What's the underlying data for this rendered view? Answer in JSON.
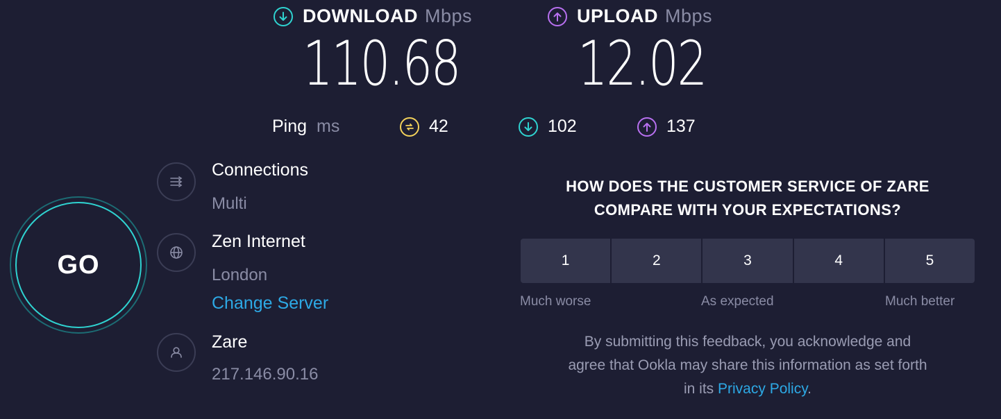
{
  "download": {
    "title": "DOWNLOAD",
    "unit": "Mbps",
    "value": "110.68",
    "icon": "arrow-down-circle-icon",
    "color": "#2fd3d1"
  },
  "upload": {
    "title": "UPLOAD",
    "unit": "Mbps",
    "value": "12.02",
    "icon": "arrow-up-circle-icon",
    "color": "#b870f0"
  },
  "ping": {
    "label": "Ping",
    "unit": "ms",
    "idle": {
      "value": "42",
      "icon": "ping-idle-icon",
      "color": "#f2d15a"
    },
    "download": {
      "value": "102",
      "icon": "ping-download-icon",
      "color": "#2fd3d1"
    },
    "upload": {
      "value": "137",
      "icon": "ping-upload-icon",
      "color": "#b870f0"
    }
  },
  "go_button": {
    "label": "GO"
  },
  "connections": {
    "title": "Connections",
    "value": "Multi",
    "icon": "connections-icon"
  },
  "server": {
    "title": "Zen Internet",
    "location": "London",
    "change_label": "Change Server",
    "icon": "globe-icon"
  },
  "provider": {
    "title": "Zare",
    "ip": "217.146.90.16",
    "icon": "user-icon"
  },
  "survey": {
    "question_line1": "HOW DOES THE CUSTOMER SERVICE OF ZARE",
    "question_line2": "COMPARE WITH YOUR EXPECTATIONS?",
    "ratings": [
      "1",
      "2",
      "3",
      "4",
      "5"
    ],
    "label_low": "Much worse",
    "label_mid": "As expected",
    "label_high": "Much better",
    "disclaimer_line1": "By submitting this feedback, you acknowledge and",
    "disclaimer_line2": "agree that Ookla may share this information as set forth",
    "disclaimer_line3_prefix": "in its",
    "privacy_link": "Privacy Policy",
    "disclaimer_line3_suffix": "."
  },
  "colors": {
    "background": "#1d1e33",
    "accent_cyan": "#2fd3d1",
    "accent_purple": "#b870f0",
    "accent_yellow": "#f2d15a",
    "link": "#2da9e5"
  }
}
